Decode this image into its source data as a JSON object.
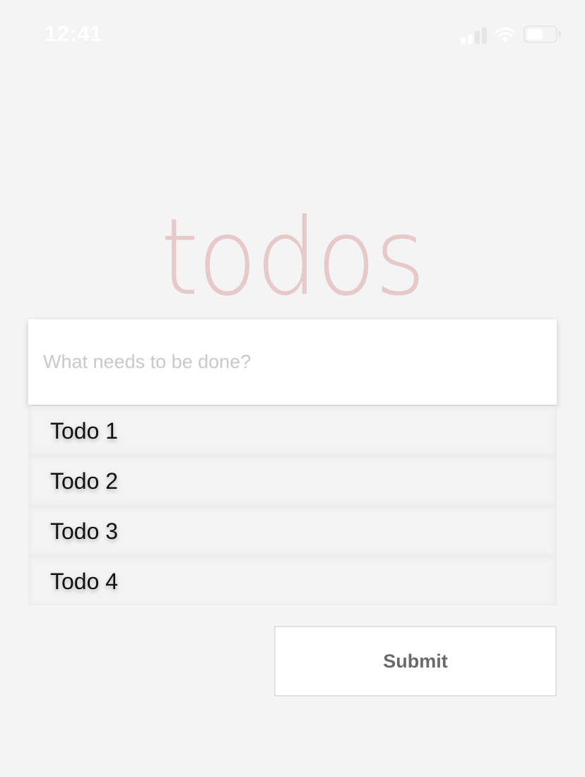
{
  "status_bar": {
    "time": "12:41",
    "icons": [
      "cellular-signal-icon",
      "wifi-icon",
      "battery-icon"
    ],
    "battery_level": 0.55
  },
  "header": {
    "title": "todos"
  },
  "new_todo": {
    "value": "",
    "placeholder": "What needs to be done?"
  },
  "todos": [
    {
      "label": "Todo 1"
    },
    {
      "label": "Todo 2"
    },
    {
      "label": "Todo 3"
    },
    {
      "label": "Todo 4"
    }
  ],
  "actions": {
    "submit_label": "Submit"
  },
  "colors": {
    "background": "#f4f4f4",
    "title": "#e7c9c9",
    "placeholder": "#c9c9c9",
    "button_text": "#6a6a6a"
  }
}
